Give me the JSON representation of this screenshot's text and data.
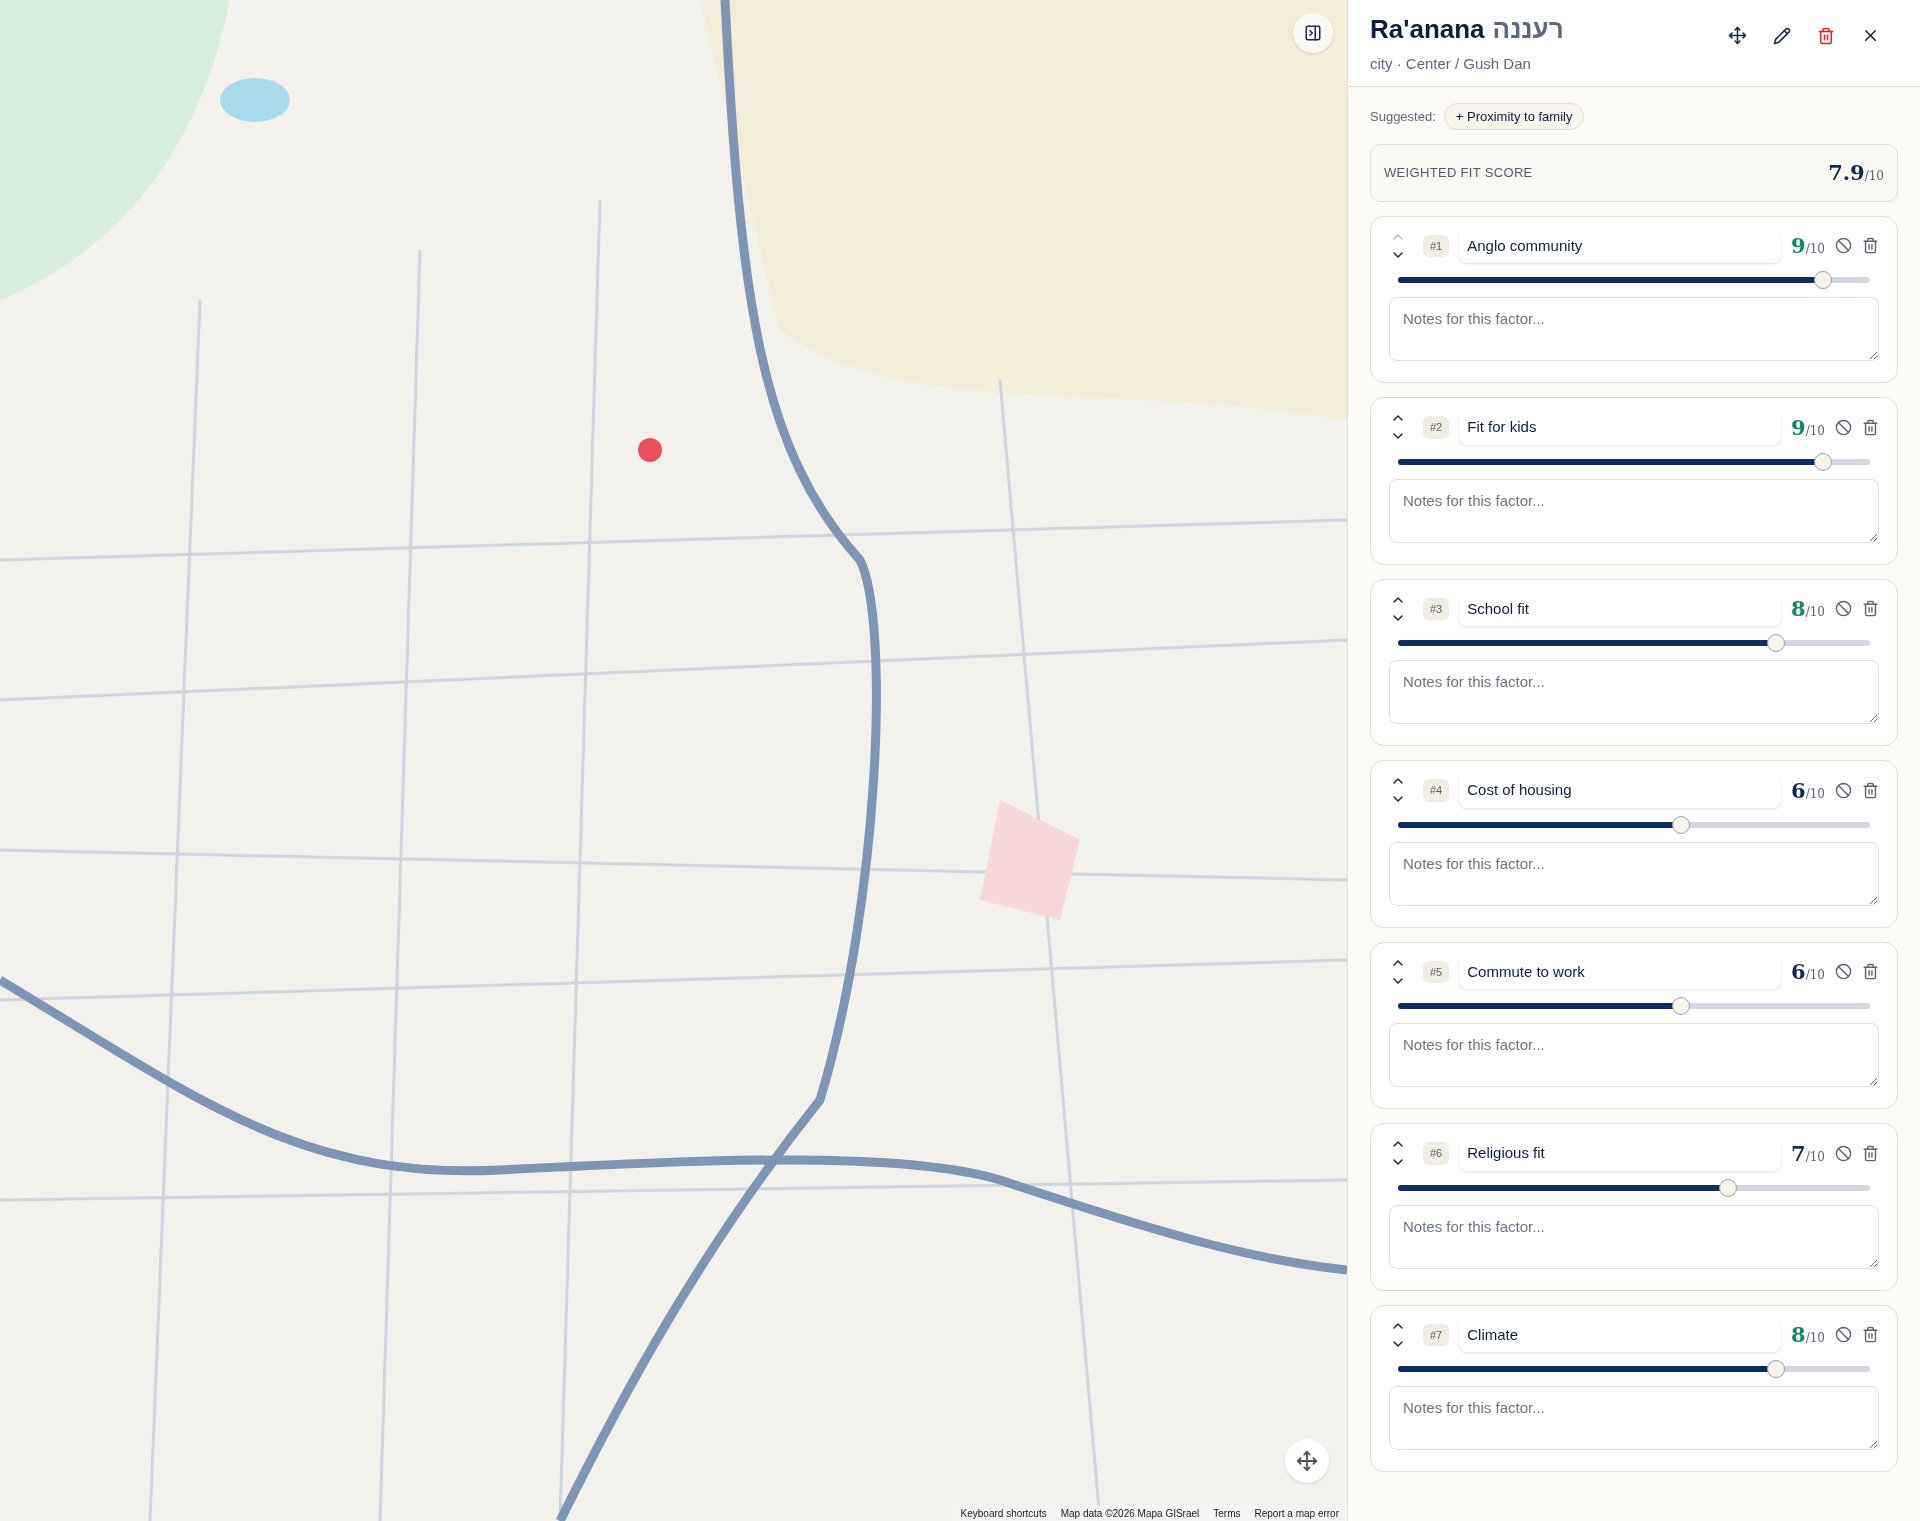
{
  "map": {
    "attribution": [
      "Keyboard shortcuts",
      "Map data ©2026 Mapa GISrael",
      "Terms",
      "Report a map error"
    ]
  },
  "panel": {
    "title": "Ra'anana",
    "title_hebrew": "רעננה",
    "subtitle": "city · Center / Gush Dan",
    "suggested_label": "Suggested:",
    "suggestions": [
      "+ Proximity to family"
    ],
    "score_label": "WEIGHTED FIT SCORE",
    "score": "7.9",
    "score_max": "/10",
    "factors": [
      {
        "rank": "#1",
        "name": "Anglo community",
        "score": "9",
        "max": "/10",
        "level": 0.9,
        "up_disabled": true,
        "notes_placeholder": "Notes for this factor..."
      },
      {
        "rank": "#2",
        "name": "Fit for kids",
        "score": "9",
        "max": "/10",
        "level": 0.9,
        "up_disabled": false,
        "notes_placeholder": "Notes for this factor..."
      },
      {
        "rank": "#3",
        "name": "School fit",
        "score": "8",
        "max": "/10",
        "level": 0.8,
        "up_disabled": false,
        "notes_placeholder": "Notes for this factor..."
      },
      {
        "rank": "#4",
        "name": "Cost of housing",
        "score": "6",
        "max": "/10",
        "level": 0.6,
        "up_disabled": false,
        "notes_placeholder": "Notes for this factor..."
      },
      {
        "rank": "#5",
        "name": "Commute to work",
        "score": "6",
        "max": "/10",
        "level": 0.6,
        "up_disabled": false,
        "notes_placeholder": "Notes for this factor..."
      },
      {
        "rank": "#6",
        "name": "Religious fit",
        "score": "7",
        "max": "/10",
        "level": 0.7,
        "up_disabled": false,
        "notes_placeholder": "Notes for this factor..."
      },
      {
        "rank": "#7",
        "name": "Climate",
        "score": "8",
        "max": "/10",
        "level": 0.8,
        "up_disabled": false,
        "notes_placeholder": "Notes for this factor..."
      }
    ]
  }
}
